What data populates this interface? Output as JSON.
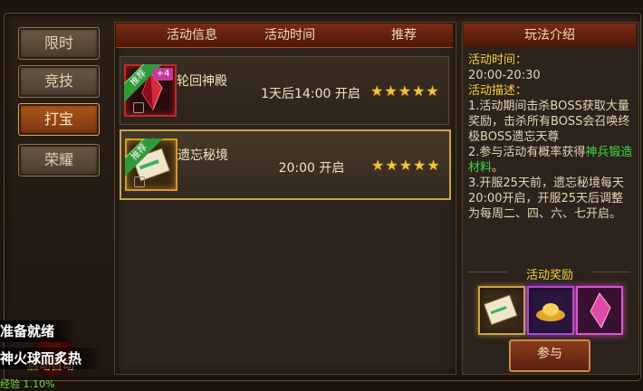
{
  "tabs": [
    {
      "label": "限时",
      "active": false
    },
    {
      "label": "竞技",
      "active": false
    },
    {
      "label": "打宝",
      "active": true
    },
    {
      "label": "荣耀",
      "active": false
    }
  ],
  "list": {
    "columns": [
      "活动信息",
      "活动时间",
      "推荐"
    ],
    "rows": [
      {
        "name": "轮回神殿",
        "time": "1天后14:00 开启",
        "stars": "★★★★★",
        "badge": "推荐",
        "item_tag": "+4",
        "selected": false
      },
      {
        "name": "遗忘秘境",
        "time": "20:00 开启",
        "stars": "★★★★★",
        "badge": "推荐",
        "selected": true
      }
    ]
  },
  "info": {
    "title": "玩法介绍",
    "time_label": "活动时间：",
    "time_value": "20:00-20:30",
    "desc_label": "活动描述：",
    "desc_1": "1.活动期间击杀BOSS获取大量奖励，击杀所有BOSS会召唤终极BOSS遗忘天尊",
    "desc_2_a": "2.参与活动有概率获得",
    "desc_2_b": "神兵锻造材料",
    "desc_2_c": "。",
    "desc_3": "3.开服25天前，遗忘秘境每天20:00开启，开服25天后调整为每周二、四、六、七开启。",
    "reward_title": "活动奖励",
    "join_label": "参与"
  },
  "notifications": {
    "line1": "准备就绪",
    "line2": "神火球而炙热",
    "under_text": "启动自动",
    "bottom_text": "经验 1.10%"
  },
  "colors": {
    "accent": "#f5d23a",
    "highlight_green": "#3fd84a",
    "tab_active": "#b0581c"
  }
}
